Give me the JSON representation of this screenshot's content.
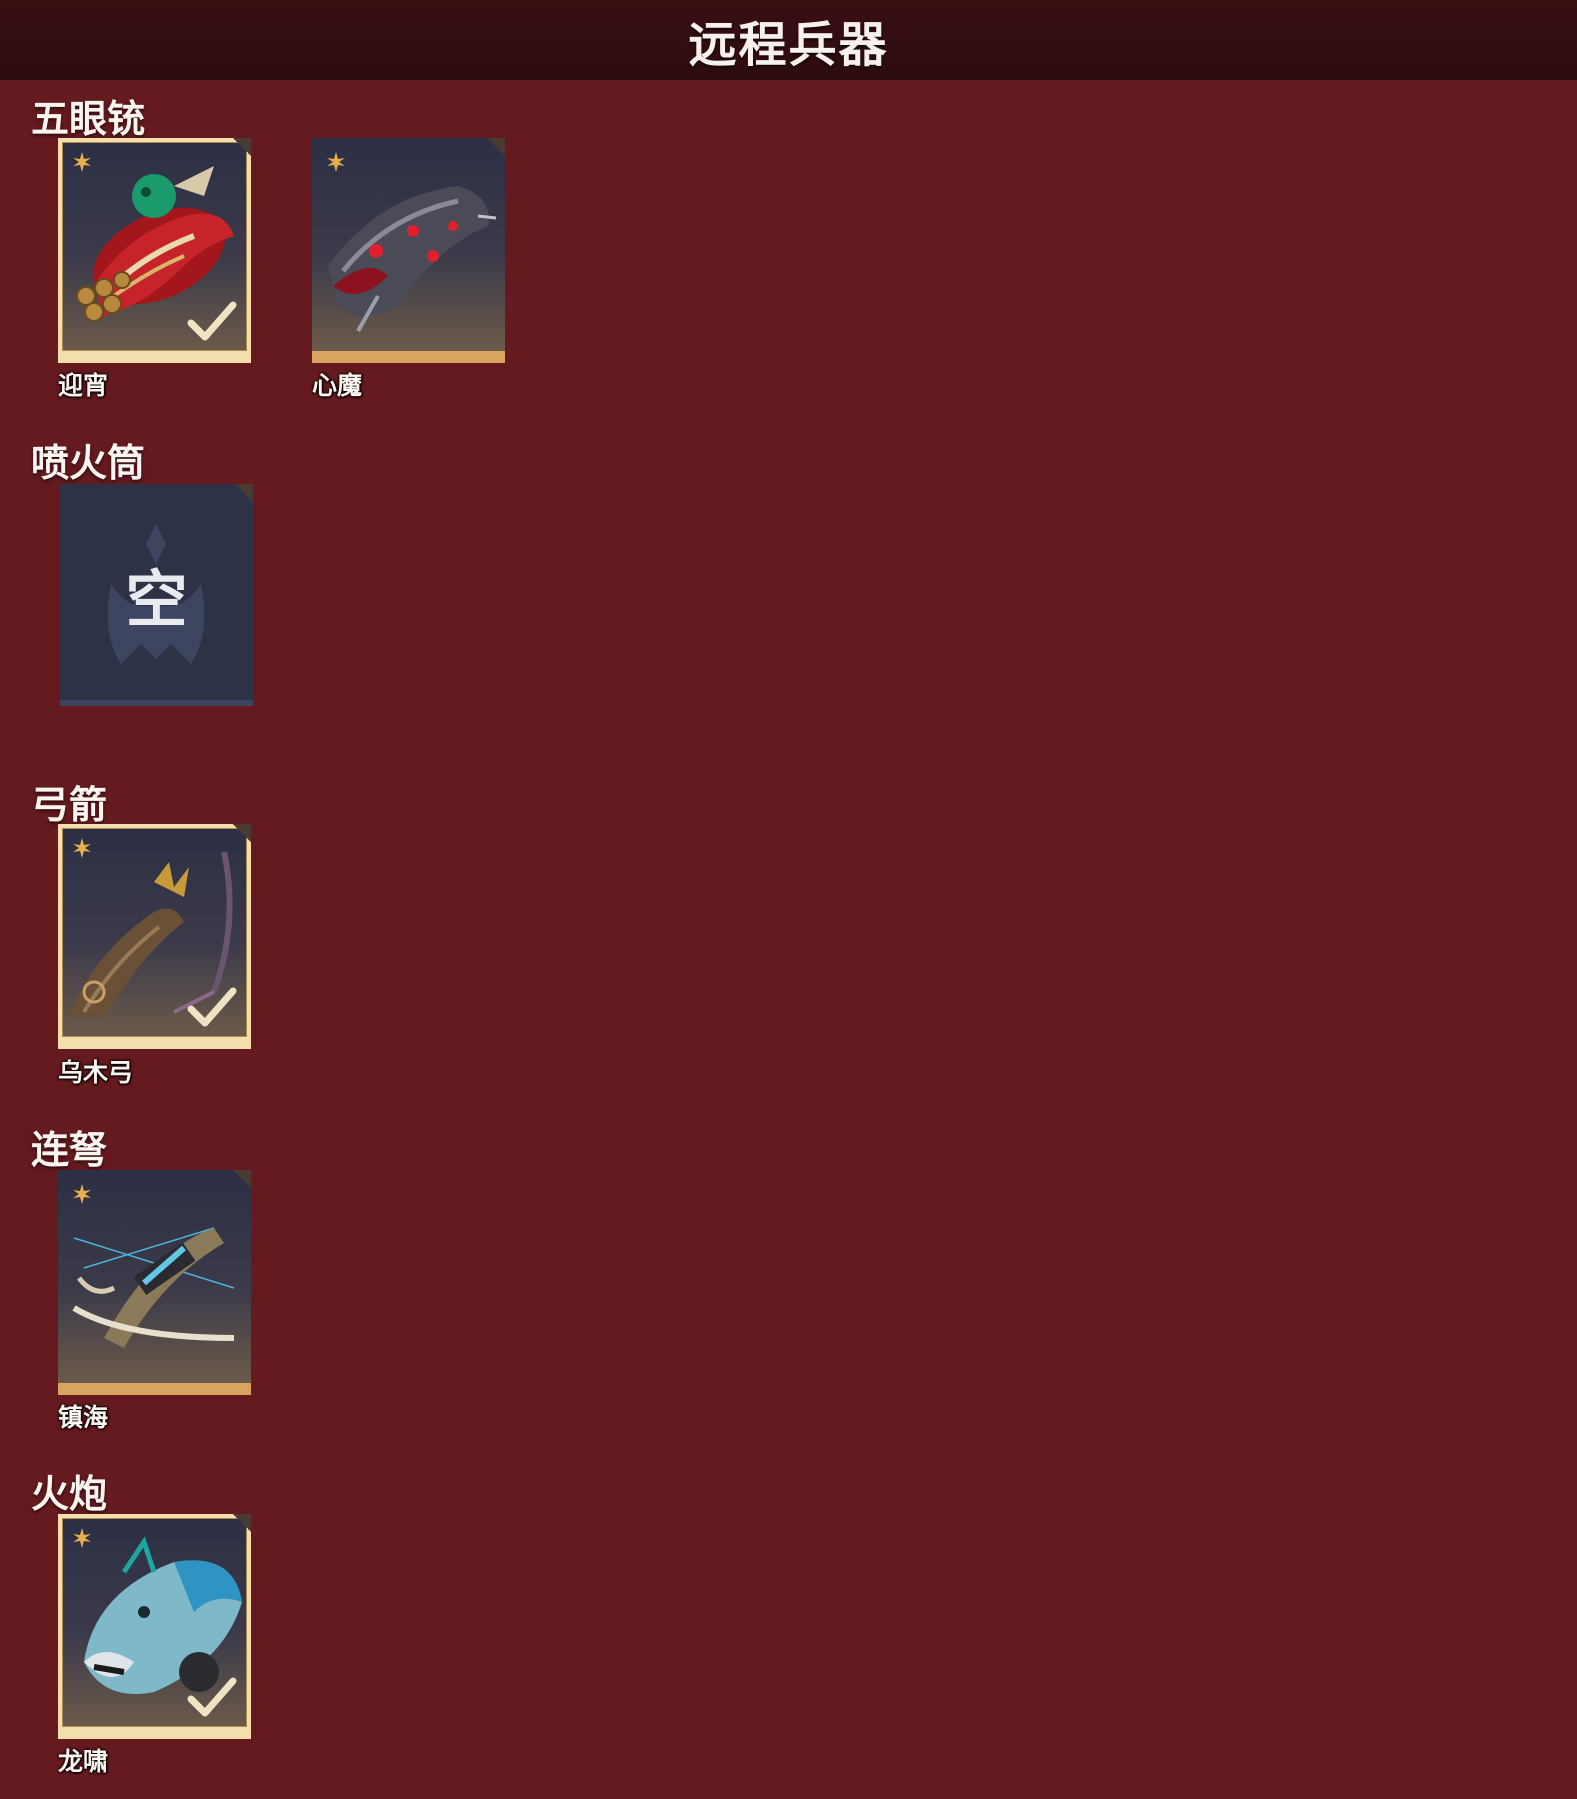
{
  "header": {
    "title": "远程兵器"
  },
  "sections": [
    {
      "title": "五眼铳",
      "items": [
        {
          "name": "迎宵",
          "selected": true,
          "icon": "dragon-cannon-red-icon"
        },
        {
          "name": "心魔",
          "selected": false,
          "icon": "demon-cannon-dark-icon"
        }
      ]
    },
    {
      "title": "喷火筒",
      "items": [
        {
          "name": "",
          "empty_label": "空",
          "selected": false,
          "icon": "empty-slot-emblem-icon"
        }
      ]
    },
    {
      "title": "弓箭",
      "items": [
        {
          "name": "乌木弓",
          "selected": true,
          "icon": "ebony-bow-icon"
        }
      ]
    },
    {
      "title": "连弩",
      "items": [
        {
          "name": "镇海",
          "selected": false,
          "icon": "repeating-crossbow-icon"
        }
      ]
    },
    {
      "title": "火炮",
      "items": [
        {
          "name": "龙啸",
          "selected": true,
          "icon": "dragon-head-cannon-icon"
        }
      ]
    }
  ],
  "colors": {
    "background": "#641a1f",
    "header": "#2c0c0e",
    "selected_border": "#f3dfae",
    "card_bottom_accent": "#d8a45f"
  }
}
